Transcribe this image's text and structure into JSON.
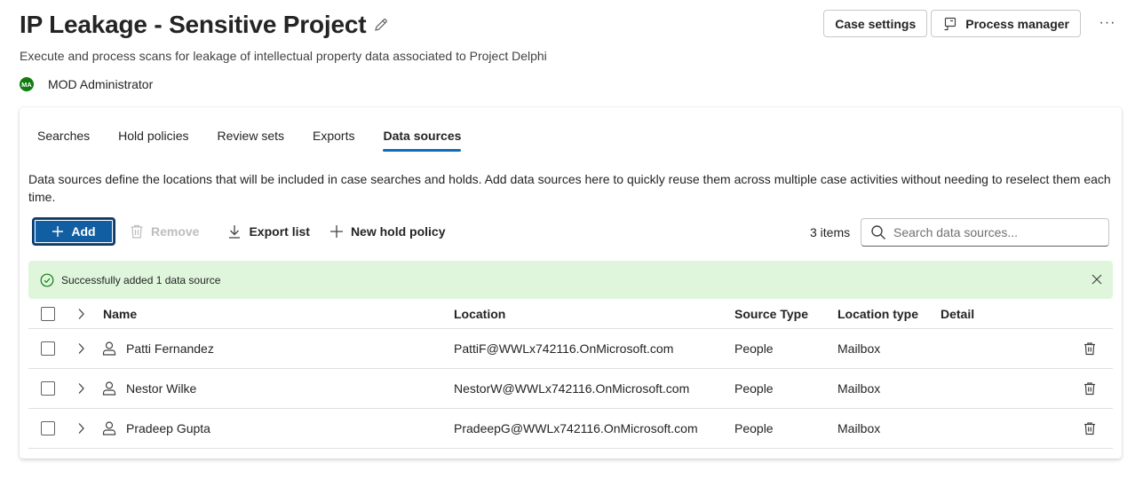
{
  "header": {
    "title": "IP Leakage - Sensitive Project",
    "subtitle": "Execute and process scans for leakage of intellectual property data associated to Project Delphi",
    "owner_initials": "MA",
    "owner_name": "MOD Administrator",
    "case_settings_label": "Case settings",
    "process_manager_label": "Process manager",
    "more_label": "···"
  },
  "tabs": [
    {
      "label": "Searches",
      "active": false
    },
    {
      "label": "Hold policies",
      "active": false
    },
    {
      "label": "Review sets",
      "active": false
    },
    {
      "label": "Exports",
      "active": false
    },
    {
      "label": "Data sources",
      "active": true
    }
  ],
  "description": "Data sources define the locations that will be included in case searches and holds. Add data sources here to quickly reuse them across multiple case activities without needing to reselect them each time.",
  "toolbar": {
    "add_label": "Add",
    "remove_label": "Remove",
    "export_label": "Export list",
    "new_hold_label": "New hold policy",
    "item_count": "3 items",
    "search_placeholder": "Search data sources..."
  },
  "banner": {
    "message": "Successfully added 1 data source"
  },
  "table": {
    "columns": {
      "name": "Name",
      "location": "Location",
      "source_type": "Source Type",
      "location_type": "Location type",
      "detail": "Detail"
    },
    "rows": [
      {
        "name": "Patti Fernandez",
        "location": "PattiF@WWLx742116.OnMicrosoft.com",
        "source_type": "People",
        "location_type": "Mailbox",
        "detail": ""
      },
      {
        "name": "Nestor Wilke",
        "location": "NestorW@WWLx742116.OnMicrosoft.com",
        "source_type": "People",
        "location_type": "Mailbox",
        "detail": ""
      },
      {
        "name": "Pradeep Gupta",
        "location": "PradeepG@WWLx742116.OnMicrosoft.com",
        "source_type": "People",
        "location_type": "Mailbox",
        "detail": ""
      }
    ]
  },
  "colors": {
    "accent": "#0f6cbd",
    "primary_button": "#115ea3",
    "success_banner": "#dff6dd",
    "success_icon": "#107c10",
    "avatar": "#107c10"
  }
}
